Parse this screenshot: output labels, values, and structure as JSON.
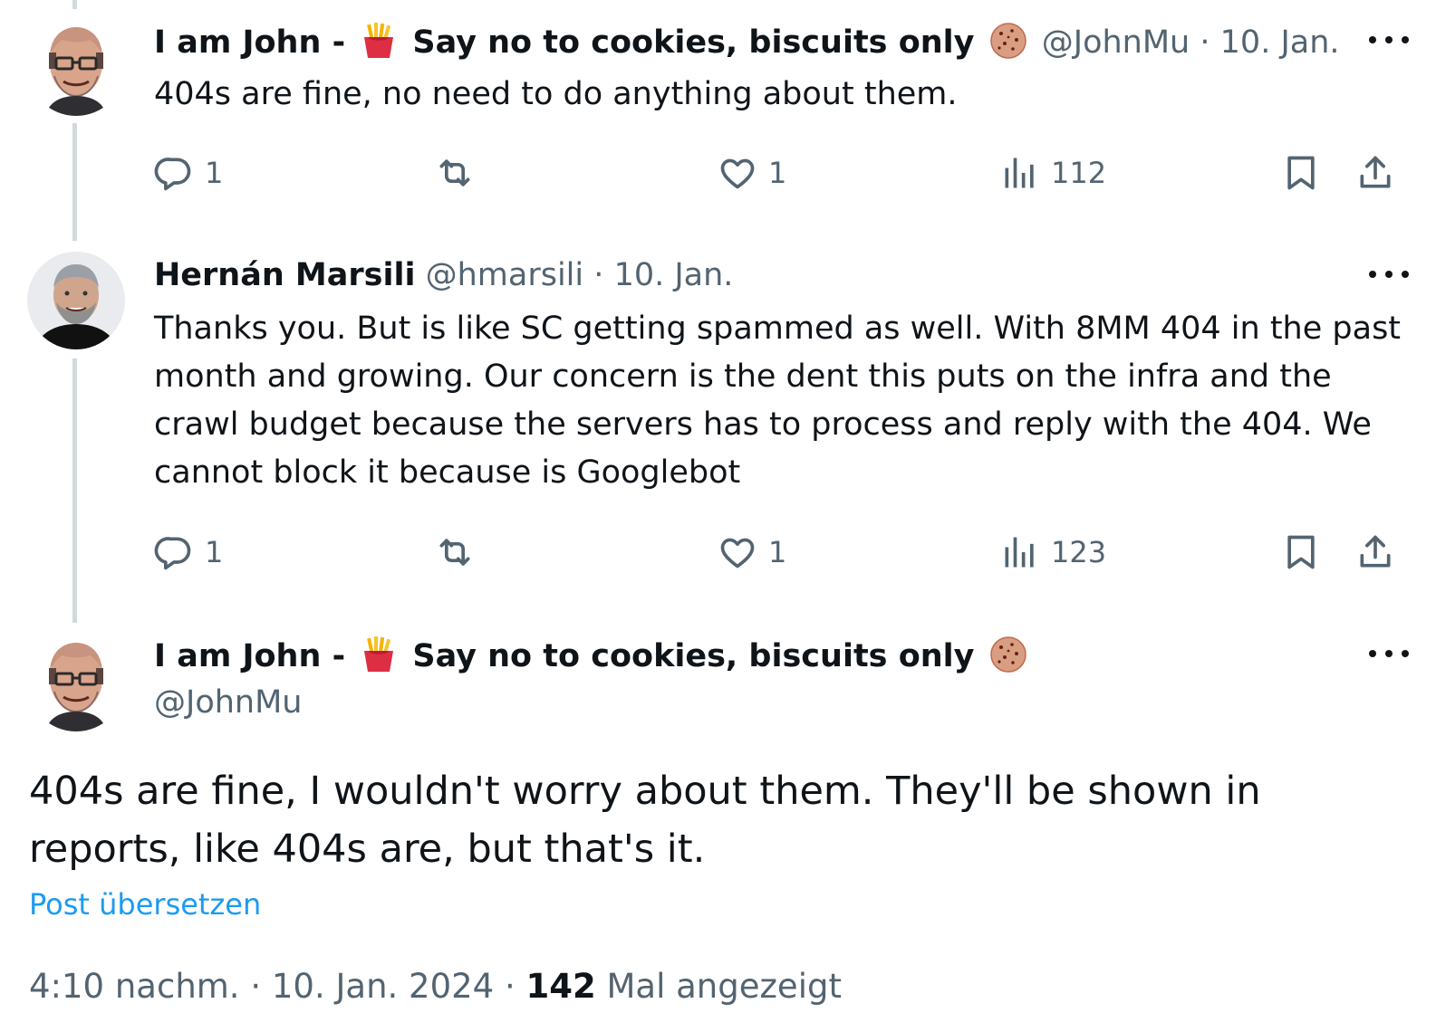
{
  "thread": [
    {
      "author_name_a": "I am John -",
      "author_name_b": "Say no to cookies, biscuits only",
      "handle": "@JohnMu",
      "separator": "·",
      "date": "10. Jan.",
      "text": "404s are fine, no need to do anything about them.",
      "replies": "1",
      "likes": "1",
      "views": "112",
      "emoji_1": "french-fries",
      "emoji_2": "cookie"
    },
    {
      "author_name": "Hernán Marsili",
      "handle": "@hmarsili",
      "separator": "·",
      "date": "10. Jan.",
      "text": "Thanks you. But is like SC getting spammed as well. With 8MM 404 in the past month and growing. Our concern is the dent this puts on the infra and the crawl budget because the servers has to process and reply with the 404. We cannot block it because is Googlebot",
      "replies": "1",
      "likes": "1",
      "views": "123"
    }
  ],
  "main_post": {
    "author_name_a": "I am John -",
    "author_name_b": "Say no to cookies, biscuits only",
    "handle": "@JohnMu",
    "text": "404s are fine, I wouldn't worry about them. They'll be shown in reports, like 404s are, but that's it.",
    "translate_label": "Post übersetzen",
    "time": "4:10 nachm.",
    "separator": "·",
    "date": "10. Jan. 2024",
    "views_count": "142",
    "views_label": "Mal angezeigt"
  },
  "icons": [
    "reply-icon",
    "repost-icon",
    "like-icon",
    "views-icon",
    "bookmark-icon",
    "share-icon",
    "more-icon",
    "french-fries-emoji",
    "cookie-emoji"
  ],
  "colors": {
    "text": "#0f1419",
    "muted": "#536471",
    "link": "#1d9bf0",
    "thread_line": "#cfd9de"
  }
}
